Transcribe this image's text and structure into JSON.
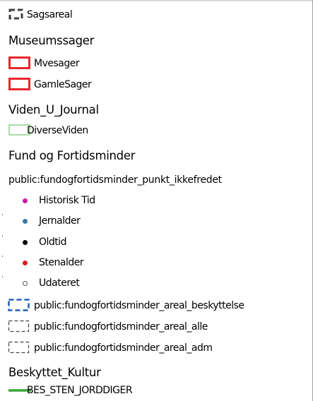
{
  "legend": {
    "sagsareal": {
      "label": "Sagsareal",
      "icon": "dashed-square-icon",
      "color": "#404040"
    },
    "museumssager": {
      "heading": "Museumssager",
      "items": [
        {
          "label": "Mvesager",
          "icon": "red-square-icon",
          "color": "#e8262d"
        },
        {
          "label": "GamleSager",
          "icon": "red-square-icon",
          "color": "#e8262d"
        }
      ]
    },
    "viden": {
      "heading": "Viden_U_Journal",
      "items": [
        {
          "label": "DiverseViden",
          "icon": "green-square-icon",
          "color": "#8fd08c"
        }
      ]
    },
    "fund": {
      "heading": "Fund og Fortidsminder",
      "sublayer": "public:fundogfortidsminder_punkt_ikkefredet",
      "points": [
        {
          "label": "Historisk Tid",
          "icon": "magenta-dot-icon",
          "color": "#c81fa8"
        },
        {
          "label": "Jernalder",
          "icon": "blue-dot-icon",
          "color": "#3e7aa8"
        },
        {
          "label": "Oldtid",
          "icon": "black-dot-icon",
          "color": "#000000"
        },
        {
          "label": "Stenalder",
          "icon": "red-dot-icon",
          "color": "#d42020"
        },
        {
          "label": "Udateret",
          "icon": "hollow-dot-icon",
          "color": "#555555"
        }
      ],
      "areas": [
        {
          "label": "public:fundogfortidsminder_areal_beskyttelse",
          "icon": "blue-dashed-square-icon",
          "color": "#1f5fb8"
        },
        {
          "label": "public:fundogfortidsminder_areal_alle",
          "icon": "grey-dashed-square-icon",
          "color": "#444444"
        },
        {
          "label": "public:fundogfortidsminder_areal_adm",
          "icon": "grey-dashed-square-icon",
          "color": "#444444"
        }
      ]
    },
    "beskyttet": {
      "heading": "Beskyttet_Kultur",
      "items": [
        {
          "label": "BES_STEN_JORDDIGER",
          "icon": "green-line-icon",
          "color": "#3aa63a"
        }
      ]
    }
  }
}
